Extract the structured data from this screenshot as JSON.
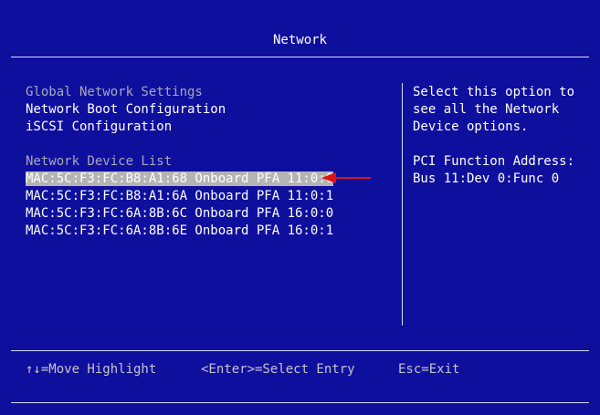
{
  "header": {
    "title": "Network"
  },
  "menu": {
    "global_settings": "Global Network Settings",
    "boot_config": "Network Boot Configuration",
    "iscsi_config": "iSCSI Configuration",
    "device_list_label": "Network Device List",
    "devices": [
      "MAC:5C:F3:FC:B8:A1:68 Onboard PFA 11:0:0",
      "MAC:5C:F3:FC:B8:A1:6A Onboard PFA 11:0:1",
      "MAC:5C:F3:FC:6A:8B:6C Onboard PFA 16:0:0",
      "MAC:5C:F3:FC:6A:8B:6E Onboard PFA 16:0:1"
    ],
    "selected_index": 0
  },
  "help": {
    "lines": [
      "Select this option to",
      "see all the Network",
      "Device options.",
      "",
      "PCI Function Address:",
      "Bus 11:Dev 0:Func 0"
    ]
  },
  "footer": {
    "move": "↑↓=Move Highlight",
    "select": "<Enter>=Select Entry",
    "exit": "Esc=Exit"
  },
  "colors": {
    "background": "#0f0f9e",
    "highlight": "#b4b4b4",
    "arrow": "#e01414"
  }
}
